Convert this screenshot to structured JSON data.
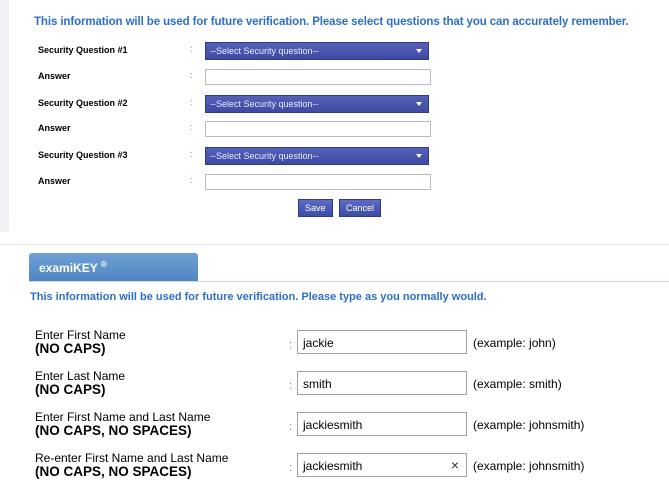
{
  "security": {
    "intro": "This information will be used for future verification. Please select questions that you can accurately remember.",
    "questions": [
      {
        "label": "Security Question #1",
        "answer_label": "Answer",
        "select_value": "--Select Security question--",
        "answer_value": ""
      },
      {
        "label": "Security Question #2",
        "answer_label": "Answer",
        "select_value": "--Select Security question--",
        "answer_value": ""
      },
      {
        "label": "Security Question #3",
        "answer_label": "Answer",
        "select_value": "--Select Security question--",
        "answer_value": ""
      }
    ],
    "colon": ":",
    "save_label": "Save",
    "cancel_label": "Cancel"
  },
  "examikey": {
    "tab_label": "examiKEY",
    "tab_mark": "®",
    "intro": "This information will be used for future verification. Please type as you normally would.",
    "colon": ":",
    "fields": [
      {
        "label": "Enter First Name",
        "note": "(NO CAPS)",
        "value": "jackie",
        "example": "(example: john)"
      },
      {
        "label": "Enter Last Name",
        "note": "(NO CAPS)",
        "value": "smith",
        "example": "(example: smith)"
      },
      {
        "label": "Enter First Name and Last Name",
        "note": "(NO CAPS, NO SPACES)",
        "value": "jackiesmith",
        "example": "(example: johnsmith)"
      },
      {
        "label": "Re-enter First Name and Last Name",
        "note": "(NO CAPS, NO SPACES)",
        "value": "jackiesmith",
        "example": "(example: johnsmith)",
        "clear_icon": "×"
      }
    ]
  }
}
